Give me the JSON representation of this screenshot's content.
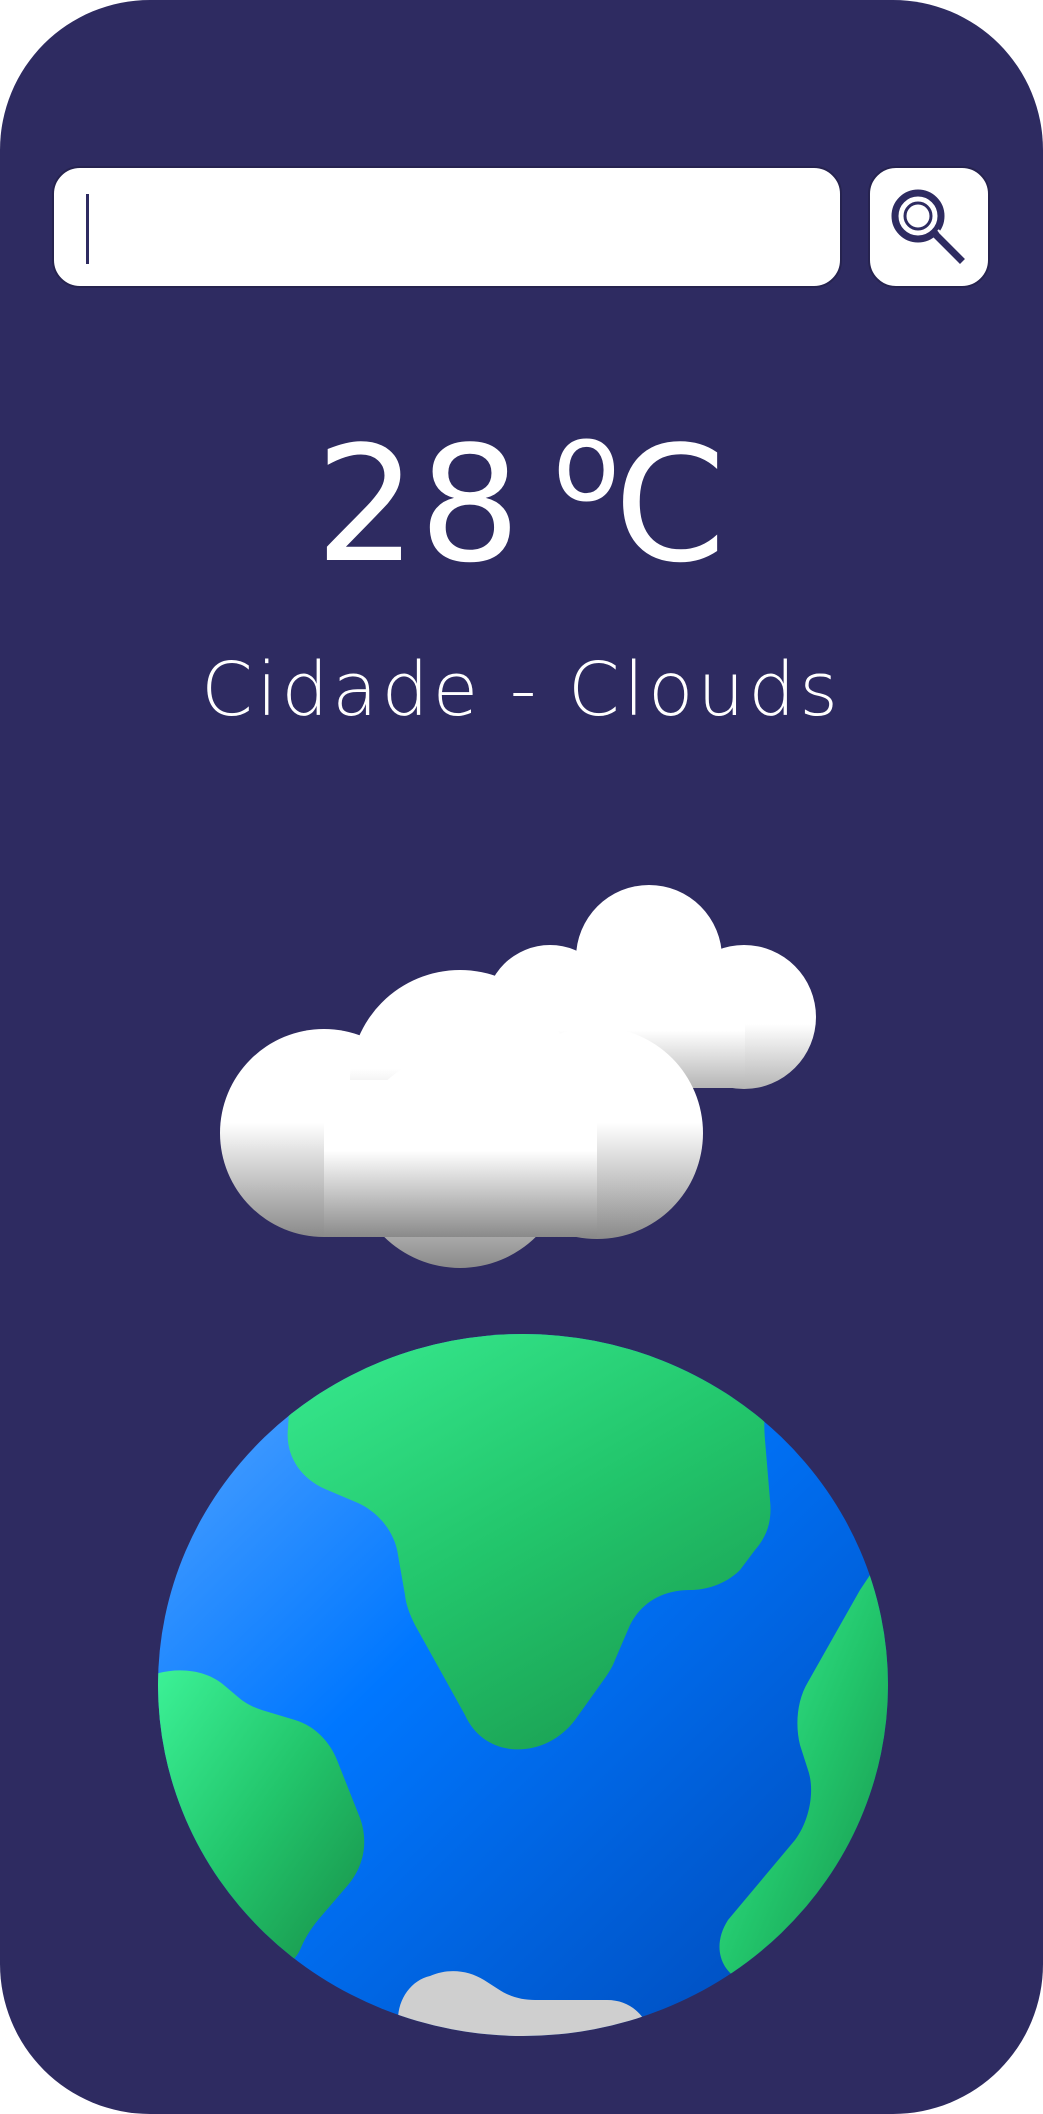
{
  "search": {
    "value": "",
    "placeholder": ""
  },
  "weather": {
    "temperature": "28",
    "degree_symbol": "o",
    "unit": "C",
    "city": "Cidade",
    "separator": "-",
    "condition": "Clouds"
  },
  "icons": {
    "search_button": "search-icon",
    "weather": "clouds-icon",
    "globe": "earth-globe"
  },
  "colors": {
    "background": "#2e2b61",
    "text": "#ffffff",
    "ocean": "#0077ff",
    "land": "#2ecc71",
    "cloud": "#ffffff"
  }
}
